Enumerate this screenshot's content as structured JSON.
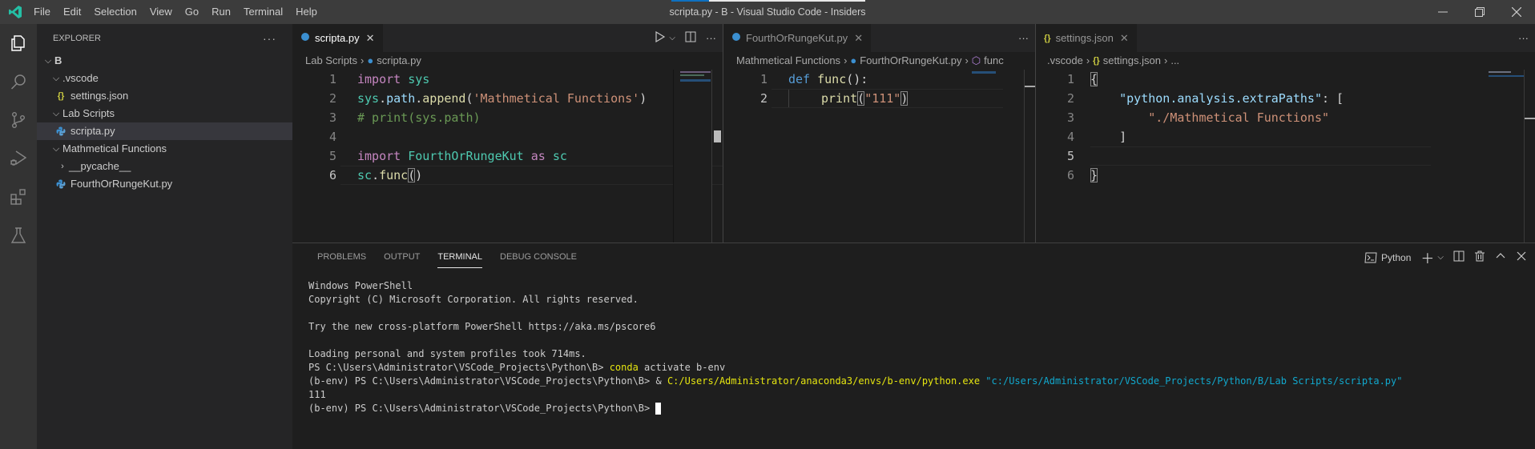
{
  "titlebar": {
    "menu": [
      "File",
      "Edit",
      "Selection",
      "View",
      "Go",
      "Run",
      "Terminal",
      "Help"
    ],
    "window_title": "scripta.py - B - Visual Studio Code - Insiders",
    "logo_icon": "vscode-insiders-logo-icon",
    "controls": [
      "minimize-icon",
      "restore-icon",
      "close-icon"
    ]
  },
  "activitybar": {
    "items": [
      "explorer-icon",
      "search-icon",
      "source-control-icon",
      "run-debug-icon",
      "extensions-icon",
      "testing-icon"
    ],
    "active": "explorer-icon"
  },
  "sidebar": {
    "title": "EXPLORER",
    "more_label": "···",
    "tree": [
      {
        "label": "B",
        "type": "root",
        "expanded": true,
        "depth": 0
      },
      {
        "label": ".vscode",
        "type": "folder",
        "expanded": true,
        "depth": 1
      },
      {
        "label": "settings.json",
        "type": "json",
        "depth": 2
      },
      {
        "label": "Lab Scripts",
        "type": "folder",
        "expanded": true,
        "depth": 1
      },
      {
        "label": "scripta.py",
        "type": "python",
        "depth": 2,
        "selected": true
      },
      {
        "label": "Mathmetical Functions",
        "type": "folder",
        "expanded": true,
        "depth": 1
      },
      {
        "label": "__pycache__",
        "type": "folder",
        "expanded": false,
        "depth": 2
      },
      {
        "label": "FourthOrRungeKut.py",
        "type": "python",
        "depth": 2
      }
    ]
  },
  "editors": [
    {
      "tab_label": "scripta.py",
      "breadcrumb": [
        "Lab Scripts",
        "scripta.py"
      ],
      "current_line": 6,
      "lines": [
        "import sys",
        "sys.path.append('Mathmetical Functions')",
        "# print(sys.path)",
        "",
        "import FourthOrRungeKut as sc",
        "sc.func()"
      ]
    },
    {
      "tab_label": "FourthOrRungeKut.py",
      "breadcrumb": [
        "Mathmetical Functions",
        "FourthOrRungeKut.py",
        "func"
      ],
      "current_line": 2,
      "lines": [
        "def func():",
        "    print(\"111\")"
      ]
    },
    {
      "tab_label": "settings.json",
      "breadcrumb": [
        ".vscode",
        "settings.json",
        "..."
      ],
      "current_line": 5,
      "lines": [
        "{",
        "    \"python.analysis.extraPaths\": [",
        "        \"./Mathmetical Functions\"",
        "    ]",
        "",
        "}"
      ]
    }
  ],
  "panel": {
    "tabs": [
      "PROBLEMS",
      "OUTPUT",
      "TERMINAL",
      "DEBUG CONSOLE"
    ],
    "active_tab": "TERMINAL",
    "terminal_name": "Python",
    "terminal_lines": [
      "Windows PowerShell",
      "Copyright (C) Microsoft Corporation. All rights reserved.",
      "",
      "Try the new cross-platform PowerShell https://aka.ms/pscore6",
      "",
      "Loading personal and system profiles took 714ms."
    ],
    "cmd1": {
      "prompt": "PS C:\\Users\\Administrator\\VSCode_Projects\\Python\\B> ",
      "command": "conda",
      "args": " activate b-env"
    },
    "cmd2": {
      "prompt": "(b-env) PS C:\\Users\\Administrator\\VSCode_Projects\\Python\\B> & ",
      "exe": "C:/Users/Administrator/anaconda3/envs/b-env/python.exe",
      "arg": " \"c:/Users/Administrator/VSCode_Projects/Python/B/Lab Scripts/scripta.py\""
    },
    "output": "111",
    "final_prompt": "(b-env) PS C:\\Users\\Administrator\\VSCode_Projects\\Python\\B> "
  }
}
